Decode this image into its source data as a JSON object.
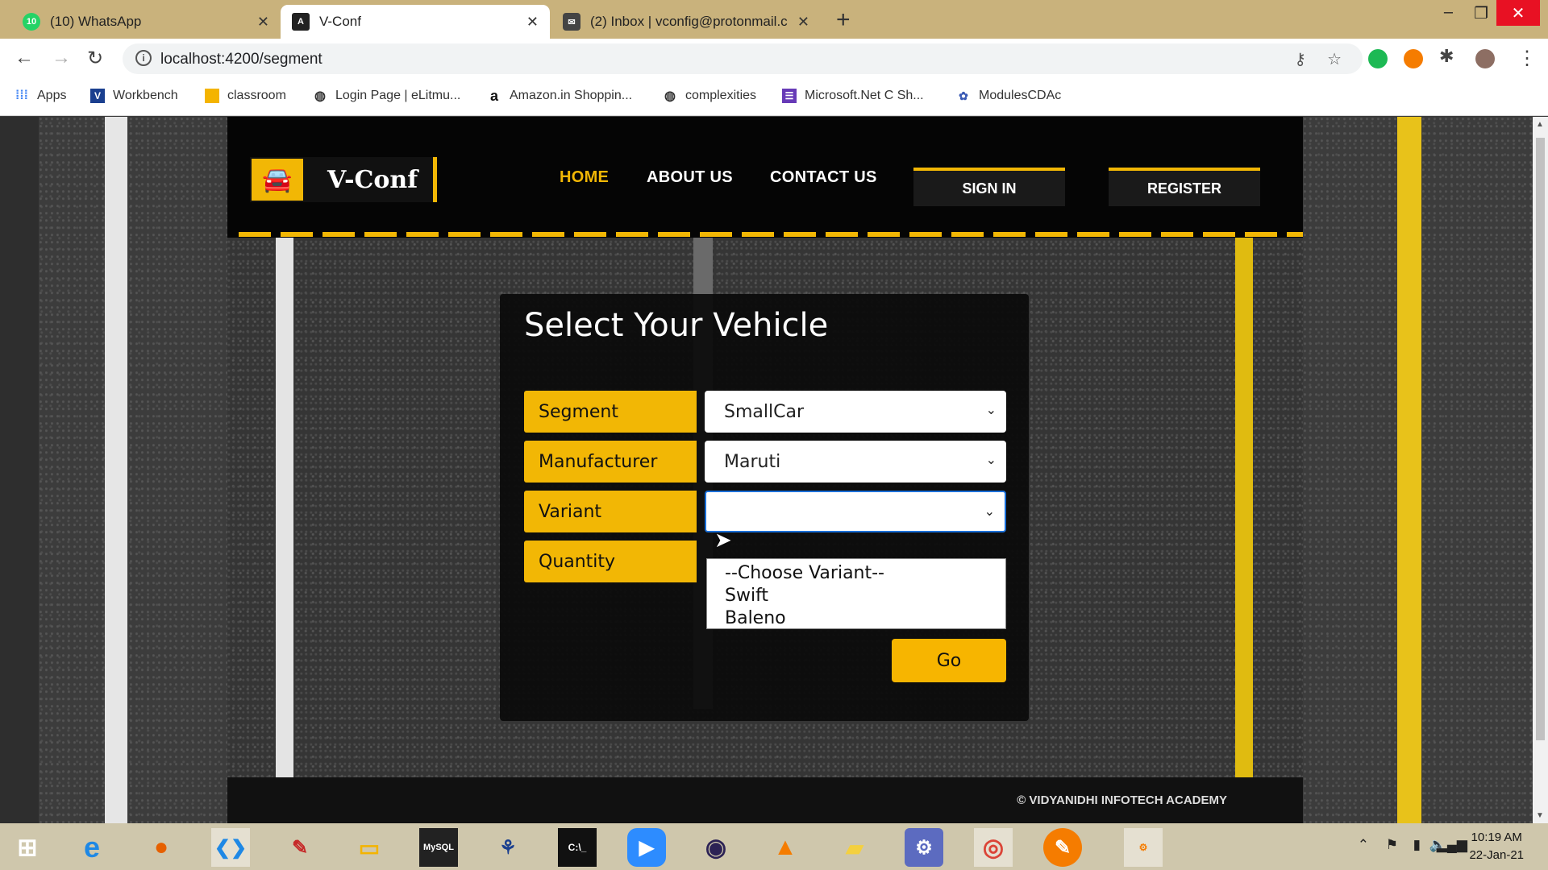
{
  "browser": {
    "tabs": [
      {
        "label": "(10) WhatsApp",
        "badge": "10",
        "icon": "whatsapp-icon"
      },
      {
        "label": "V-Conf",
        "icon": "angular-icon"
      },
      {
        "label": "(2) Inbox | vconfig@protonmail.c",
        "icon": "protonmail-icon"
      }
    ],
    "url": "localhost:4200/segment",
    "bookmarks": [
      {
        "label": "Apps",
        "icon": "apps-grid-icon"
      },
      {
        "label": "Workbench",
        "icon": "vtop-icon"
      },
      {
        "label": "classroom",
        "icon": "classroom-icon"
      },
      {
        "label": "Login Page | eLitmu...",
        "icon": "globe-icon"
      },
      {
        "label": "Amazon.in Shoppin...",
        "icon": "amazon-icon"
      },
      {
        "label": "complexities",
        "icon": "globe-icon"
      },
      {
        "label": "Microsoft.Net C Sh...",
        "icon": "forms-icon"
      },
      {
        "label": "ModulesCDAc",
        "icon": "cdac-icon"
      }
    ]
  },
  "site": {
    "logo_text": "V-Conf",
    "menu": {
      "home": "HOME",
      "about": "ABOUT US",
      "contact": "CONTACT US"
    },
    "auth": {
      "signin": "SIGN IN",
      "register": "REGISTER"
    },
    "form": {
      "title": "Select Your Vehicle",
      "segment_label": "Segment",
      "segment_value": "SmallCar",
      "manufacturer_label": "Manufacturer",
      "manufacturer_value": "Maruti",
      "variant_label": "Variant",
      "variant_value": "",
      "variant_options": [
        "--Choose Variant--",
        "Swift",
        "Baleno"
      ],
      "quantity_label": "Quantity",
      "go_label": "Go"
    },
    "footer": "© VIDYANIDHI INFOTECH ACADEMY"
  },
  "taskbar": {
    "time": "10:19 AM",
    "date": "22-Jan-21"
  },
  "colors": {
    "accent": "#f2b705",
    "header": "#050505",
    "tabbar": "#c9b27c"
  }
}
